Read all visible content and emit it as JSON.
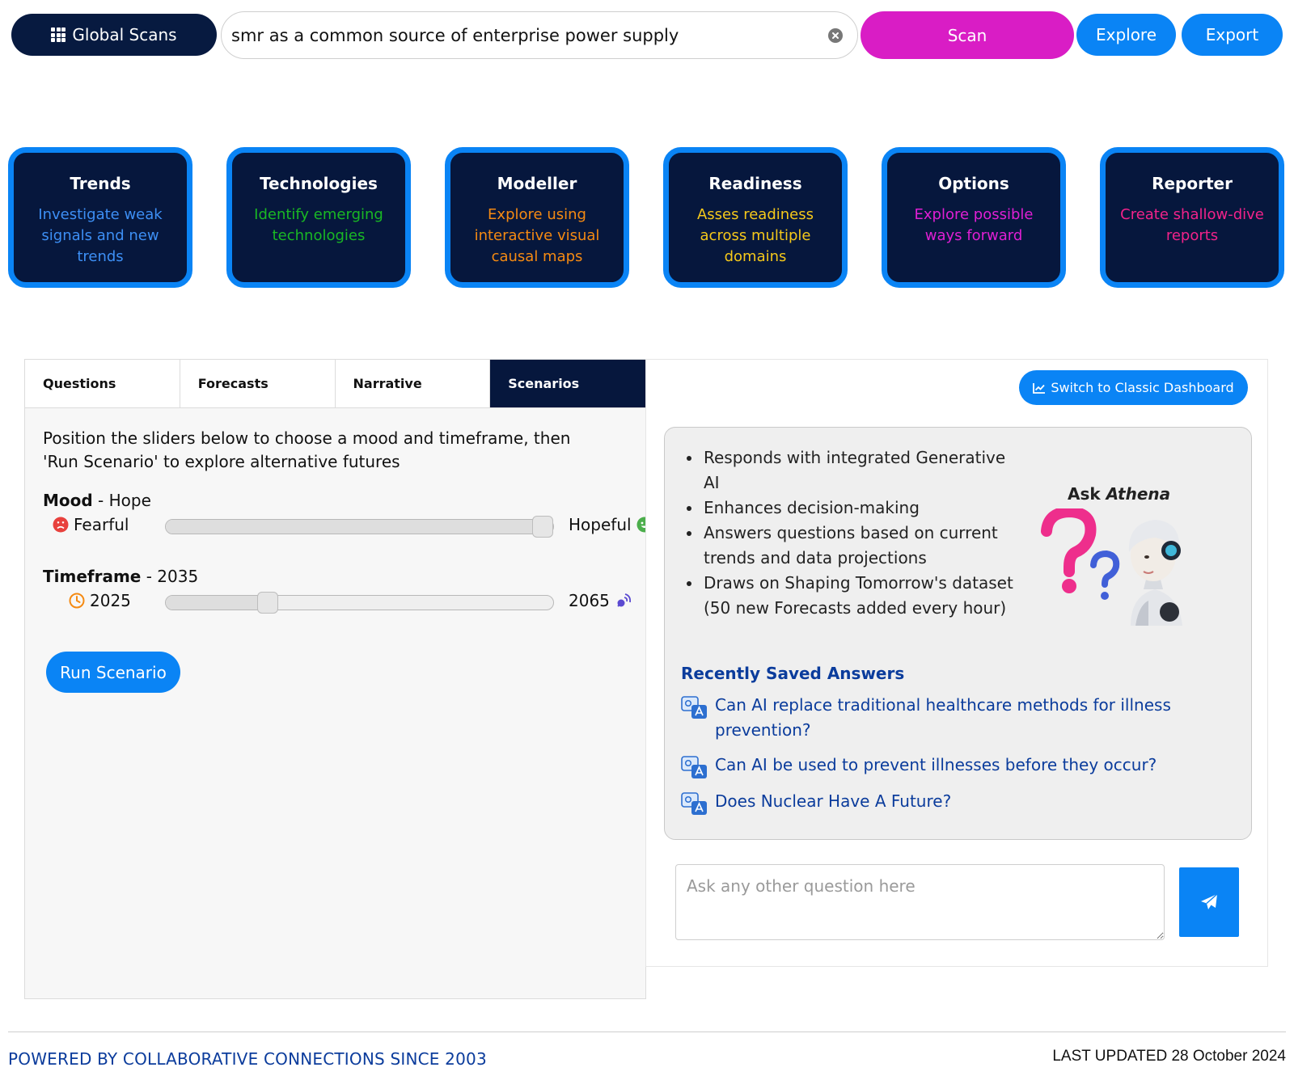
{
  "topbar": {
    "global_scans_label": "Global Scans",
    "search_value": "smr as a common source of enterprise power supply",
    "scan_label": "Scan",
    "explore_label": "Explore",
    "export_label": "Export"
  },
  "modules": [
    {
      "title": "Trends",
      "desc": "Investigate weak signals and new trends",
      "color": "#3d8ff5"
    },
    {
      "title": "Technologies",
      "desc": "Identify emerging technologies",
      "color": "#19b824"
    },
    {
      "title": "Modeller",
      "desc": "Explore using interactive visual causal maps",
      "color": "#f58a12"
    },
    {
      "title": "Readiness",
      "desc": "Asses readiness across multiple domains",
      "color": "#f5c81a"
    },
    {
      "title": "Options",
      "desc": "Explore possible ways forward",
      "color": "#e01fd4"
    },
    {
      "title": "Reporter",
      "desc": "Create shallow-dive reports",
      "color": "#f2228a"
    }
  ],
  "left_panel": {
    "tabs": [
      "Questions",
      "Forecasts",
      "Narrative",
      "Scenarios"
    ],
    "active_tab": "Scenarios",
    "intro": "Position the sliders below to choose a mood and timeframe, then 'Run Scenario' to explore alternative futures",
    "mood": {
      "label": "Mood",
      "value_text": " - Hope",
      "left_label": "Fearful",
      "right_label": "Hopeful",
      "position": 1.0
    },
    "timeframe": {
      "label": "Timeframe",
      "value_text": " - 2035",
      "left_label": "2025",
      "right_label": "2065",
      "min": 2025,
      "max": 2065,
      "value": 2035
    },
    "run_label": "Run Scenario"
  },
  "right_panel": {
    "switch_label": "Switch to Classic Dashboard",
    "bullets": [
      "Responds with integrated Generative AI",
      "Enhances decision-making",
      "Answers questions based on current trends and data projections",
      "Draws on Shaping Tomorrow's dataset (50 new Forecasts added every hour)"
    ],
    "ask_title_prefix": "Ask ",
    "ask_title_name": "Athena",
    "saved_title": "Recently Saved Answers",
    "saved": [
      "Can AI replace traditional healthcare methods for illness prevention?",
      "Can AI be used to prevent illnesses before they occur?",
      "Does Nuclear Have A Future?"
    ],
    "ask_placeholder": "Ask any other question here"
  },
  "footer": {
    "powered": "POWERED BY COLLABORATIVE CONNECTIONS SINCE 2003",
    "updated": "LAST UPDATED 28 October 2024"
  },
  "colors": {
    "navy": "#06173d",
    "blue": "#0a84f5",
    "magenta": "#d91dc5",
    "link": "#0b3c9c"
  },
  "icons": {
    "global_scans": "grid-icon",
    "clear": "close-circle-icon",
    "fearful": "frown-face-icon",
    "hopeful": "smile-face-icon",
    "start_year": "clock-icon",
    "end_year": "satellite-icon",
    "switch": "line-chart-icon",
    "saved_answer": "qa-chat-icon",
    "send": "paper-plane-icon"
  }
}
